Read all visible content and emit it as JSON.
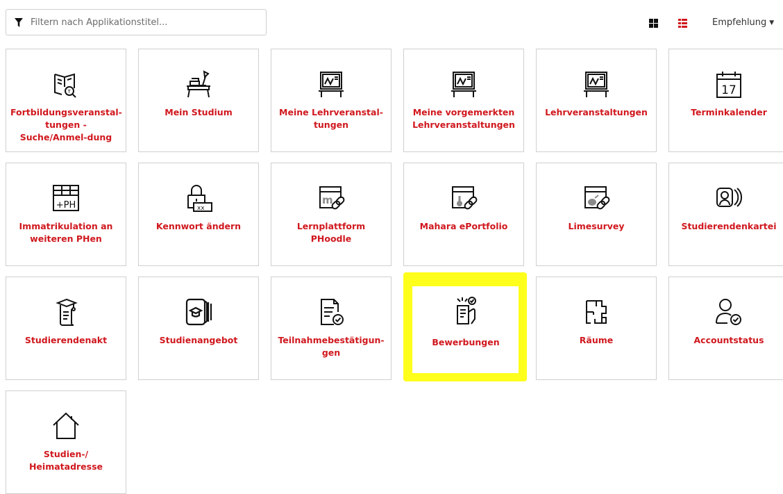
{
  "filter": {
    "placeholder": "Filtern nach Applikationstitel...",
    "value": ""
  },
  "view": {
    "grid_icon": "grid-view-icon",
    "list_icon": "list-view-icon",
    "active_color": "#d0181e"
  },
  "sort": {
    "label": "Empfehlung"
  },
  "accent_color": "#d0181e",
  "highlight_color": "#ffff1c",
  "tiles": [
    {
      "label": "Fortbildungsveranstal-tungen - Suche/Anmel-dung",
      "icon": "book-search-icon"
    },
    {
      "label": "Mein Studium",
      "icon": "study-desk-icon"
    },
    {
      "label": "Meine Lehrveranstal-tungen",
      "icon": "blackboard-icon"
    },
    {
      "label": "Meine vorgemerkten Lehrveranstaltungen",
      "icon": "blackboard-icon"
    },
    {
      "label": "Lehrveranstaltungen",
      "icon": "blackboard-icon"
    },
    {
      "label": "Terminkalender",
      "icon": "calendar-icon",
      "icon_text": "17"
    },
    {
      "label": "Immatrikulation an weiteren PHen",
      "icon": "enrollment-icon",
      "icon_text": "+PH"
    },
    {
      "label": "Kennwort ändern",
      "icon": "password-lock-icon",
      "icon_text": "xx_"
    },
    {
      "label": "Lernplattform PHoodle",
      "icon": "moodle-link-icon"
    },
    {
      "label": "Mahara ePortfolio",
      "icon": "mahara-link-icon"
    },
    {
      "label": "Limesurvey",
      "icon": "limesurvey-link-icon"
    },
    {
      "label": "Studierendenkartei",
      "icon": "student-card-icon"
    },
    {
      "label": "Studierendenakt",
      "icon": "scroll-graduate-icon"
    },
    {
      "label": "Studienangebot",
      "icon": "course-catalog-icon"
    },
    {
      "label": "Teilnahmebestätigun-gen",
      "icon": "document-check-icon"
    },
    {
      "label": "Bewerbungen",
      "icon": "application-icon"
    },
    {
      "label": "Räume",
      "icon": "floorplan-icon"
    },
    {
      "label": "Accountstatus",
      "icon": "user-check-icon"
    },
    {
      "label": "Studien-/ Heimatadresse",
      "icon": "house-icon"
    }
  ]
}
